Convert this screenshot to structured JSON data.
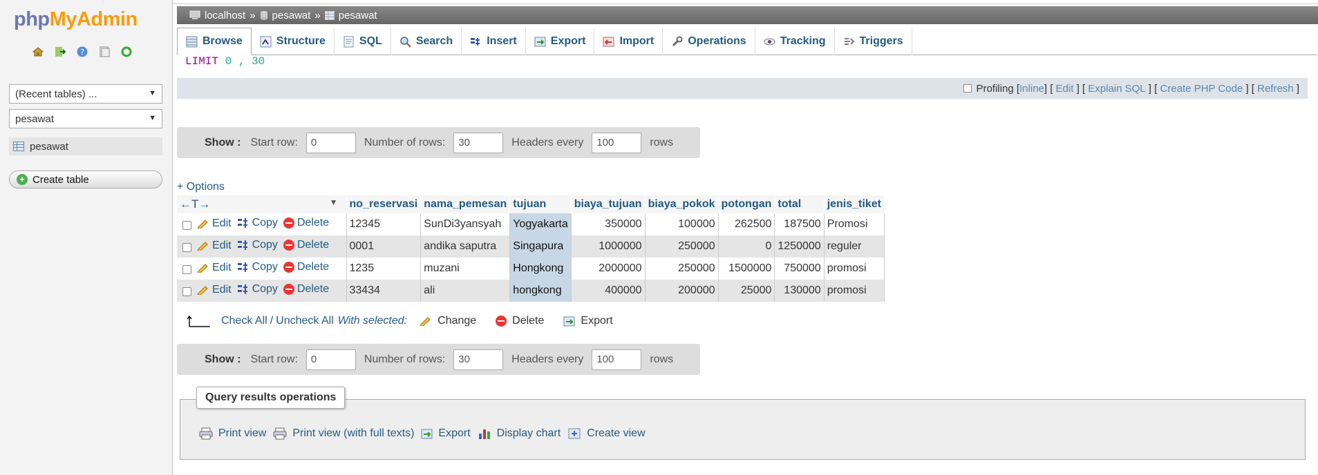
{
  "nav": {
    "logo_php": "php",
    "logo_my": "My",
    "logo_admin": "Admin",
    "recent_tables": "(Recent tables) ...",
    "database": "pesawat",
    "table": "pesawat",
    "create_table": "Create table"
  },
  "breadcrumb": {
    "server": "localhost",
    "sep1": "»",
    "database": "pesawat",
    "sep2": "»",
    "table": "pesawat"
  },
  "tabs": [
    "Browse",
    "Structure",
    "SQL",
    "Search",
    "Insert",
    "Export",
    "Import",
    "Operations",
    "Tracking",
    "Triggers"
  ],
  "sql": {
    "keyword": "LIMIT",
    "values": "0 , 30"
  },
  "profiling": {
    "label": "Profiling",
    "inline": "Inline",
    "edit": "Edit",
    "explain": "Explain SQL",
    "php": "Create PHP Code",
    "refresh": "Refresh"
  },
  "show": {
    "label": "Show :",
    "start_row_label": "Start row:",
    "start_row": "0",
    "num_rows_label": "Number of rows:",
    "num_rows": "30",
    "headers_label": "Headers every",
    "headers": "100",
    "rows_label": "rows"
  },
  "options_link": "+ Options",
  "table": {
    "arrows": "←T→",
    "columns": [
      "no_reservasi",
      "nama_pemesan",
      "tujuan",
      "biaya_tujuan",
      "biaya_pokok",
      "potongan",
      "total",
      "jenis_tiket"
    ],
    "action_labels": {
      "edit": "Edit",
      "copy": "Copy",
      "delete": "Delete"
    },
    "rows": [
      [
        "12345",
        "SunDi3yansyah",
        "Yogyakarta",
        "350000",
        "100000",
        "262500",
        "187500",
        "Promosi"
      ],
      [
        "0001",
        "andika saputra",
        "Singapura",
        "1000000",
        "250000",
        "0",
        "1250000",
        "reguler"
      ],
      [
        "1235",
        "muzani",
        "Hongkong",
        "2000000",
        "250000",
        "1500000",
        "750000",
        "promosi"
      ],
      [
        "33434",
        "ali",
        "hongkong",
        "400000",
        "200000",
        "25000",
        "130000",
        "promosi"
      ]
    ]
  },
  "with_selected": {
    "check_all": "Check All",
    "slash": "/",
    "uncheck_all": "Uncheck All",
    "label": "With selected:",
    "change": "Change",
    "delete": "Delete",
    "export": "Export"
  },
  "query_ops": {
    "legend": "Query results operations",
    "print_view": "Print view",
    "print_full": "Print view (with full texts)",
    "export": "Export",
    "display_chart": "Display chart",
    "create_view": "Create view"
  },
  "colors": {
    "link": "#235a81",
    "highlight": "#c8d7e6",
    "even_row": "#e5e5e5"
  }
}
